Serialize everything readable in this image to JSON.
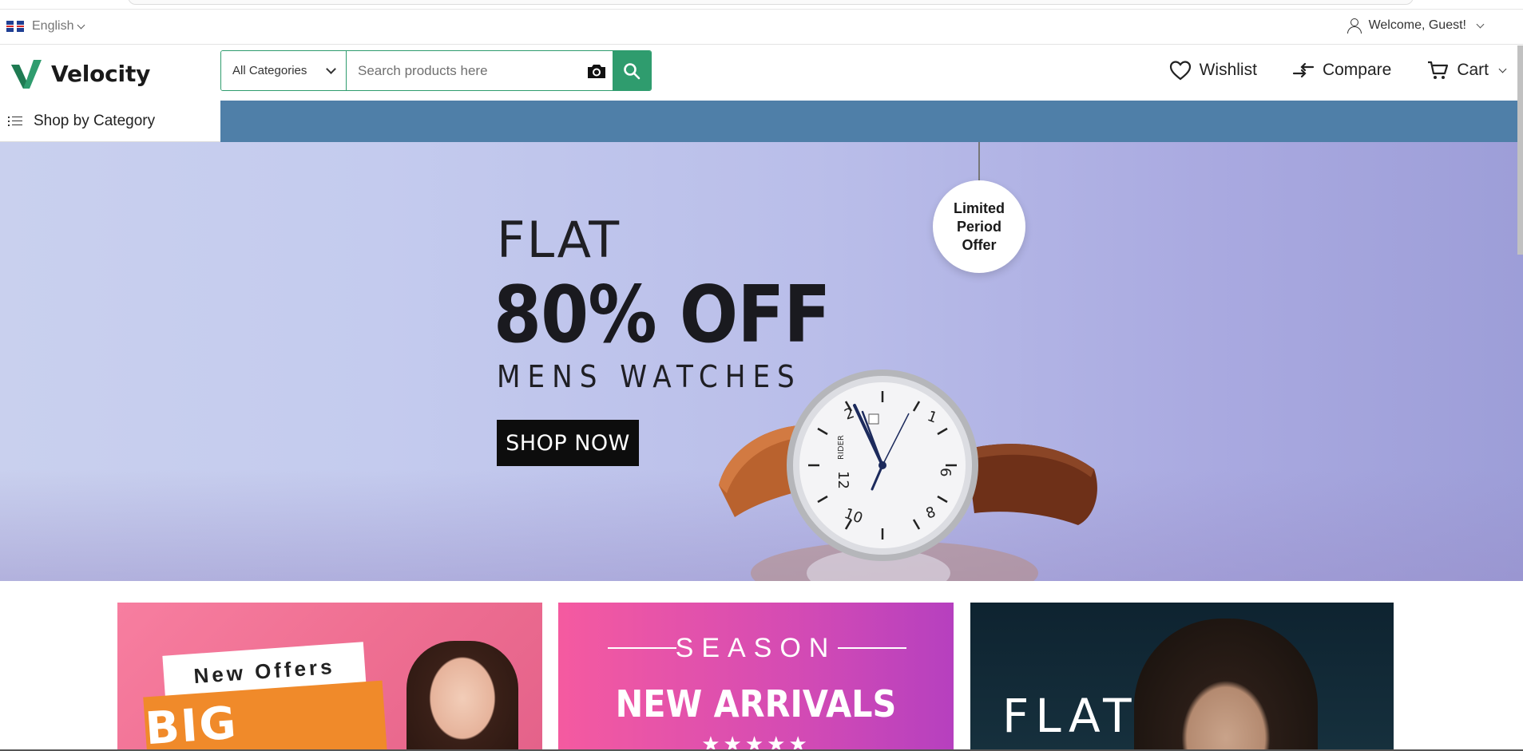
{
  "utility_bar": {
    "language": "English",
    "welcome": "Welcome, Guest!"
  },
  "header": {
    "logo_text": "Velocity",
    "category_select": "All Categories",
    "search_placeholder": "Search products here",
    "wishlist": "Wishlist",
    "compare": "Compare",
    "cart": "Cart"
  },
  "category_bar": {
    "shop_by_category": "Shop by Category"
  },
  "hero": {
    "flat": "FLAT",
    "discount": "80% OFF",
    "subtitle": "MENS WATCHES",
    "button": "SHOP NOW",
    "tag_line1": "Limited",
    "tag_line2": "Period",
    "tag_line3": "Offer",
    "watch_brand": "RIDER"
  },
  "promos": {
    "p1_offers": "New Offers",
    "p1_sale": "BIG SALE",
    "p2_season": "SEASON",
    "p2_arrivals": "NEW ARRIVALS",
    "p2_stars": "★★★★★",
    "p3_flat": "FLAT"
  },
  "colors": {
    "brand_green": "#2f9c6e",
    "category_bar": "#4f7fa8"
  }
}
